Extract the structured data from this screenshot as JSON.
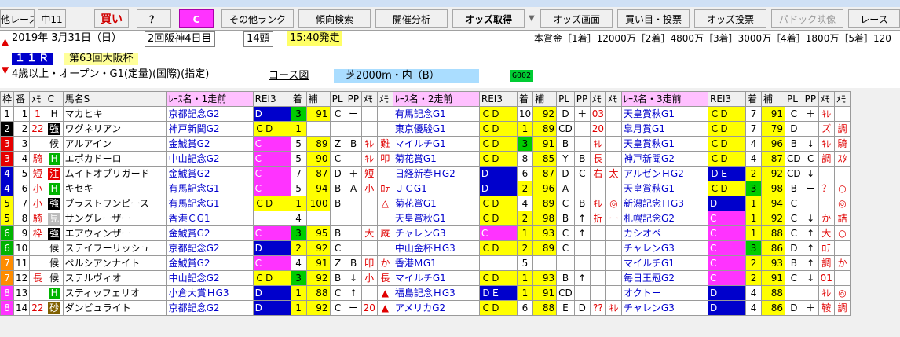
{
  "toolbar": {
    "b1": "他レース",
    "b2": "中11",
    "b3": "買い",
    "b4": "？",
    "b5": "C",
    "b6": "その他ランク",
    "b7": "傾向検索",
    "b8": "開催分析",
    "b9": "オッズ取得",
    "b10": "オッズ画面",
    "b11": "買い目・投票",
    "b12": "オッズ投票",
    "b13": "パドック映像",
    "b14": "レース"
  },
  "race": {
    "date": "2019年 3月31日（日）",
    "meeting": "2回阪神4日目",
    "heads": "14頭",
    "start": "15:40発走",
    "prize": "本賞金［1着］12000万［2着］4800万［3着］3000万［4着］1800万［5着］120",
    "number": "１１Ｒ",
    "name": "第63回大阪杯",
    "cond": "4歳以上・オープン・G1(定量)(国際)(指定)",
    "course_label": "コース図",
    "course": "芝2000m・内（B）",
    "code": "G002"
  },
  "headers": [
    "枠",
    "番",
    "ﾒﾓ",
    "C",
    "馬名S",
    "ﾚｰｽ名・1走前",
    "REI3",
    "着",
    "補",
    "PL",
    "PP",
    "ﾒﾓ",
    "ﾒﾓ",
    "ﾚｰｽ名・2走前",
    "REI3",
    "着",
    "補",
    "PL",
    "PP",
    "ﾒﾓ",
    "ﾒﾓ",
    "ﾚｰｽ名・3走前",
    "REI3",
    "着",
    "補",
    "PL",
    "PP",
    "ﾒﾓ",
    "ﾒﾓ"
  ],
  "rows": [
    {
      "waku": "1",
      "wc": "#ffffff",
      "wt": "#000",
      "num": "1",
      "memo": "1",
      "memo2": "速",
      "c": "H",
      "ct": "kou",
      "name": "マカヒキ",
      "r1": "京都記念G2",
      "e1": "D",
      "e1c": "d",
      "p1": "3",
      "p1c": "gb",
      "h1": "91",
      "pl1": "C",
      "pp1": "ー",
      "m1": "",
      "m1b": "",
      "r2": "有馬記念G1",
      "e2": "ＣＤ",
      "e2c": "cd",
      "p2": "10",
      "p2c": "",
      "h2": "92",
      "pl2": "D",
      "pp2": "＋",
      "m2": "03",
      "m2b": "",
      "r3": "天皇賞秋G1",
      "e3": "ＣＤ",
      "e3c": "cd",
      "p3": "7",
      "p3c": "",
      "h3": "91",
      "pl3": "C",
      "pp3": "＋",
      "m3": "ｷﾚ",
      "m3b": ""
    },
    {
      "waku": "2",
      "wc": "#000000",
      "wt": "#fff",
      "num": "2",
      "memo": "22",
      "memo2": "",
      "c": "強",
      "ct": "tsu",
      "name": "ワグネリアン",
      "r1": "神戸新聞G2",
      "e1": "ＣＤ",
      "e1c": "cd",
      "p1": "1",
      "p1c": "yb",
      "h1": "",
      "pl1": "",
      "pp1": "",
      "m1": "",
      "m1b": "",
      "r2": "東京優駿G1",
      "e2": "ＣＤ",
      "e2c": "cd",
      "p2": "1",
      "p2c": "yb",
      "h2": "89",
      "pl2": "CD",
      "pp2": "",
      "m2": "20",
      "m2b": "",
      "r3": "皐月賞G1",
      "e3": "ＣＤ",
      "e3c": "cd",
      "p3": "7",
      "p3c": "",
      "h3": "79",
      "pl3": "D",
      "pp3": "",
      "m3": "ズ",
      "m3b": "調"
    },
    {
      "waku": "3",
      "wc": "#e60000",
      "wt": "#fff",
      "num": "3",
      "memo": "",
      "memo2": "",
      "c": "候",
      "ct": "kou",
      "name": "アルアイン",
      "r1": "金鯱賞G2",
      "e1": "C",
      "e1c": "c-only",
      "p1": "5",
      "p1c": "",
      "h1": "89",
      "pl1": "Z",
      "pp1": "B",
      "m1": "ｷﾚ",
      "m1b": "難",
      "r2": "マイルチG1",
      "e2": "ＣＤ",
      "e2c": "cd",
      "p2": "3",
      "p2c": "gb",
      "h2": "91",
      "pl2": "B",
      "pp2": "",
      "m2": "ｷﾚ",
      "m2b": "",
      "r3": "天皇賞秋G1",
      "e3": "ＣＤ",
      "e3c": "cd",
      "p3": "4",
      "p3c": "",
      "h3": "96",
      "pl3": "B",
      "pp3": "↓",
      "m3": "ｷﾚ",
      "m3b": "騎"
    },
    {
      "waku": "3",
      "wc": "#e60000",
      "wt": "#fff",
      "num": "4",
      "memo": "騎",
      "memo2": "",
      "c": "H",
      "ct": "hb",
      "name": "エポカドーロ",
      "r1": "中山記念G2",
      "e1": "C",
      "e1c": "c-only",
      "p1": "5",
      "p1c": "",
      "h1": "90",
      "pl1": "C",
      "pp1": "",
      "m1": "ｷﾚ",
      "m1b": "叩",
      "r2": "菊花賞G1",
      "e2": "ＣＤ",
      "e2c": "cd",
      "p2": "8",
      "p2c": "",
      "h2": "85",
      "pl2": "Y",
      "pp2": "B",
      "m2": "長",
      "m2b": "",
      "r3": "神戸新聞G2",
      "e3": "ＣＤ",
      "e3c": "cd",
      "p3": "4",
      "p3c": "",
      "h3": "87",
      "pl3": "CD",
      "pp3": "C",
      "m3": "調",
      "m3b": "ｽﾀ"
    },
    {
      "waku": "4",
      "wc": "#0000cc",
      "wt": "#fff",
      "num": "5",
      "memo": "短",
      "memo2": "",
      "c": "注",
      "ct": "chu",
      "name": "ムイトオブリガード",
      "r1": "金鯱賞G2",
      "e1": "C",
      "e1c": "c-only",
      "p1": "7",
      "p1c": "",
      "h1": "87",
      "pl1": "D",
      "pp1": "＋",
      "m1": "短",
      "m1b": "",
      "r2": "日経新春ＨG2",
      "e2": "D",
      "e2c": "d",
      "p2": "6",
      "p2c": "",
      "h2": "87",
      "pl2": "D",
      "pp2": "C",
      "m2": "右",
      "m2b": "太",
      "r3": "アルゼンＨG2",
      "e3": "ＤＥ",
      "e3c": "de",
      "p3": "2",
      "p3c": "yb",
      "h3": "92",
      "pl3": "CD",
      "pp3": "↓",
      "m3": "",
      "m3b": ""
    },
    {
      "waku": "4",
      "wc": "#0000cc",
      "wt": "#fff",
      "num": "6",
      "memo": "小",
      "memo2": "",
      "c": "H",
      "ct": "hb",
      "name": "キセキ",
      "r1": "有馬記念G1",
      "e1": "C",
      "e1c": "c-only",
      "p1": "5",
      "p1c": "",
      "h1": "94",
      "pl1": "B",
      "pp1": "A",
      "m1": "小",
      "m1b": "ﾛﾃ",
      "r2": "ＪＣG1",
      "e2": "D",
      "e2c": "d",
      "p2": "2",
      "p2c": "yb",
      "h2": "96",
      "pl2": "A",
      "pp2": "",
      "m2": "",
      "m2b": "",
      "r3": "天皇賞秋G1",
      "e3": "ＣＤ",
      "e3c": "cd",
      "p3": "3",
      "p3c": "gb",
      "h3": "98",
      "pl3": "B",
      "pp3": "ー",
      "m3": "？",
      "m3b": "○"
    },
    {
      "waku": "5",
      "wc": "#ffff00",
      "wt": "#000",
      "num": "7",
      "memo": "小",
      "memo2": "",
      "c": "強",
      "ct": "tsu",
      "name": "ブラストワンピース",
      "r1": "有馬記念G1",
      "e1": "ＣＤ",
      "e1c": "cd",
      "p1": "1",
      "p1c": "yb",
      "h1": "100",
      "pl1": "B",
      "pp1": "",
      "m1": "",
      "m1b": "△",
      "r2": "菊花賞G1",
      "e2": "ＣＤ",
      "e2c": "cd",
      "p2": "4",
      "p2c": "",
      "h2": "89",
      "pl2": "C",
      "pp2": "B",
      "m2": "ｷﾚ",
      "m2b": "◎",
      "r3": "新潟記念ＨG3",
      "e3": "D",
      "e3c": "d",
      "p3": "1",
      "p3c": "yb",
      "h3": "94",
      "pl3": "C",
      "pp3": "",
      "m3": "",
      "m3b": "◎"
    },
    {
      "waku": "5",
      "wc": "#ffff00",
      "wt": "#000",
      "num": "8",
      "memo": "騎",
      "memo2": "",
      "c": "見",
      "ct": "fresh",
      "name": "サングレーザー",
      "r1": "香港ＣG1",
      "e1": "",
      "e1c": "",
      "p1": "4",
      "p1c": "",
      "h1": "",
      "pl1": "",
      "pp1": "",
      "m1": "",
      "m1b": "",
      "r2": "天皇賞秋G1",
      "e2": "ＣＤ",
      "e2c": "cd",
      "p2": "2",
      "p2c": "yb",
      "h2": "98",
      "pl2": "B",
      "pp2": "↑",
      "m2": "折",
      "m2b": "ー",
      "r3": "札幌記念G2",
      "e3": "C",
      "e3c": "c-only",
      "p3": "1",
      "p3c": "yb",
      "h3": "92",
      "pl3": "C",
      "pp3": "↓",
      "m3": "か",
      "m3b": "詰"
    },
    {
      "waku": "6",
      "wc": "#00b400",
      "wt": "#fff",
      "num": "9",
      "memo": "枠",
      "memo2": "",
      "c": "強",
      "ct": "tsu",
      "name": "エアウィンザー",
      "r1": "金鯱賞G2",
      "e1": "C",
      "e1c": "c-only",
      "p1": "3",
      "p1c": "gb",
      "h1": "95",
      "pl1": "B",
      "pp1": "",
      "m1": "大",
      "m1b": "厩",
      "r2": "チャレンG3",
      "e2": "C",
      "e2c": "c-only",
      "p2": "1",
      "p2c": "yb",
      "h2": "93",
      "pl2": "C",
      "pp2": "↑",
      "m2": "",
      "m2b": "",
      "r3": "カシオペ",
      "e3": "C",
      "e3c": "c-only",
      "p3": "1",
      "p3c": "yb",
      "h3": "88",
      "pl3": "C",
      "pp3": "↑",
      "m3": "大",
      "m3b": "○"
    },
    {
      "waku": "6",
      "wc": "#00b400",
      "wt": "#fff",
      "num": "10",
      "memo": "",
      "memo2": "",
      "c": "候",
      "ct": "kou",
      "name": "ステイフーリッシュ",
      "r1": "京都記念G2",
      "e1": "D",
      "e1c": "d",
      "p1": "2",
      "p1c": "yb",
      "h1": "92",
      "pl1": "C",
      "pp1": "",
      "m1": "",
      "m1b": "",
      "r2": "中山金杯ＨG3",
      "e2": "ＣＤ",
      "e2c": "cd",
      "p2": "2",
      "p2c": "yb",
      "h2": "89",
      "pl2": "C",
      "pp2": "",
      "m2": "",
      "m2b": "",
      "r3": "チャレンG3",
      "e3": "C",
      "e3c": "c-only",
      "p3": "3",
      "p3c": "gb",
      "h3": "86",
      "pl3": "D",
      "pp3": "↑",
      "m3": "ﾛﾃ",
      "m3b": ""
    },
    {
      "waku": "7",
      "wc": "#ff8c00",
      "wt": "#fff",
      "num": "11",
      "memo": "",
      "memo2": "",
      "c": "候",
      "ct": "kou",
      "name": "ペルシアンナイト",
      "r1": "金鯱賞G2",
      "e1": "C",
      "e1c": "c-only",
      "p1": "4",
      "p1c": "",
      "h1": "91",
      "pl1": "Z",
      "pp1": "B",
      "m1": "叩",
      "m1b": "か",
      "r2": "香港ＭG1",
      "e2": "",
      "e2c": "",
      "p2": "5",
      "p2c": "",
      "h2": "",
      "pl2": "",
      "pp2": "",
      "m2": "",
      "m2b": "",
      "r3": "マイルチG1",
      "e3": "C",
      "e3c": "c-only",
      "p3": "2",
      "p3c": "yb",
      "h3": "93",
      "pl3": "B",
      "pp3": "↑",
      "m3": "調",
      "m3b": "か"
    },
    {
      "waku": "7",
      "wc": "#ff8c00",
      "wt": "#fff",
      "num": "12",
      "memo": "長",
      "memo2": "",
      "c": "候",
      "ct": "kou",
      "name": "ステルヴィオ",
      "r1": "中山記念G2",
      "e1": "ＣＤ",
      "e1c": "cd",
      "p1": "3",
      "p1c": "gb",
      "h1": "92",
      "pl1": "B",
      "pp1": "↓",
      "m1": "小",
      "m1b": "長",
      "r2": "マイルチG1",
      "e2": "ＣＤ",
      "e2c": "cd",
      "p2": "1",
      "p2c": "yb",
      "h2": "93",
      "pl2": "B",
      "pp2": "↑",
      "m2": "",
      "m2b": "",
      "r3": "毎日王冠G2",
      "e3": "C",
      "e3c": "c-only",
      "p3": "2",
      "p3c": "yb",
      "h3": "91",
      "pl3": "C",
      "pp3": "↓",
      "m3": "01",
      "m3b": ""
    },
    {
      "waku": "8",
      "wc": "#ff33ff",
      "wt": "#fff",
      "num": "13",
      "memo": "",
      "memo2": "",
      "c": "H",
      "ct": "hb",
      "name": "スティッフェリオ",
      "r1": "小倉大賞ＨG3",
      "e1": "D",
      "e1c": "d",
      "p1": "1",
      "p1c": "yb",
      "h1": "88",
      "pl1": "C",
      "pp1": "↑",
      "m1": "",
      "m1b": "▲",
      "r2": "福島記念ＨG3",
      "e2": "ＤＥ",
      "e2c": "de",
      "p2": "1",
      "p2c": "yb",
      "h2": "91",
      "pl2": "CD",
      "pp2": "",
      "m2": "",
      "m2b": "",
      "r3": "オクトー",
      "e3": "D",
      "e3c": "d",
      "p3": "4",
      "p3c": "",
      "h3": "88",
      "pl3": "",
      "pp3": "",
      "m3": "ｷﾚ",
      "m3b": "◎"
    },
    {
      "waku": "8",
      "wc": "#ff33ff",
      "wt": "#fff",
      "num": "14",
      "memo": "22",
      "memo2": "",
      "c": "砂",
      "ct": "suna",
      "name": "ダンビュライト",
      "r1": "京都記念G2",
      "e1": "D",
      "e1c": "d",
      "p1": "1",
      "p1c": "yb",
      "h1": "92",
      "pl1": "C",
      "pp1": "ー",
      "m1": "20",
      "m1b": "▲",
      "r2": "アメリカG2",
      "e2": "ＣＤ",
      "e2c": "cd",
      "p2": "6",
      "p2c": "",
      "h2": "88",
      "pl2": "E",
      "pp2": "D",
      "m2": "??",
      "m2b": "ｷﾚ",
      "r3": "チャレンG3",
      "e3": "D",
      "e3c": "d",
      "p3": "4",
      "p3c": "",
      "h3": "86",
      "pl3": "D",
      "pp3": "＋",
      "m3": "鞍",
      "m3b": "調"
    }
  ]
}
